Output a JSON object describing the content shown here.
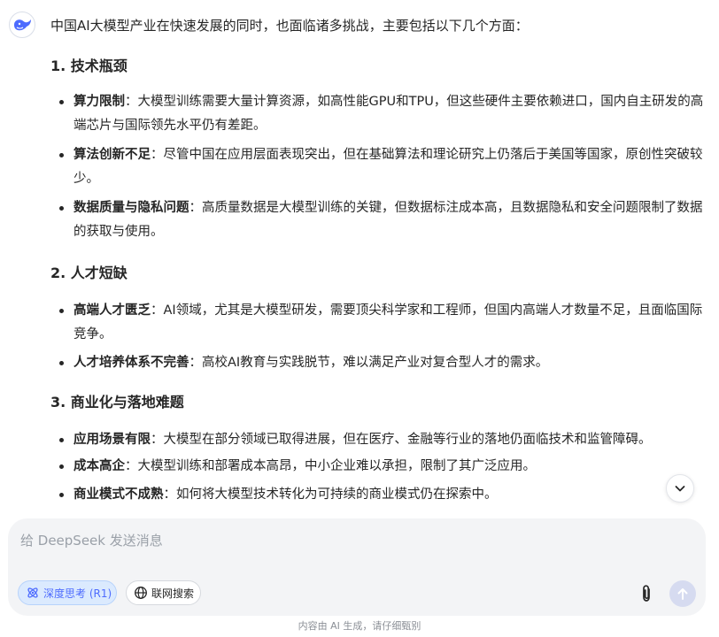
{
  "message": {
    "intro": "中国AI大模型产业在快速发展的同时，也面临诸多挑战，主要包括以下几个方面：",
    "sections": [
      {
        "title": "1. 技术瓶颈",
        "items": [
          {
            "term": "算力限制",
            "text": "：大模型训练需要大量计算资源，如高性能GPU和TPU，但这些硬件主要依赖进口，国内自主研发的高端芯片与国际领先水平仍有差距。"
          },
          {
            "term": "算法创新不足",
            "text": "：尽管中国在应用层面表现突出，但在基础算法和理论研究上仍落后于美国等国家，原创性突破较少。"
          },
          {
            "term": "数据质量与隐私问题",
            "text": "：高质量数据是大模型训练的关键，但数据标注成本高，且数据隐私和安全问题限制了数据的获取与使用。"
          }
        ]
      },
      {
        "title": "2. 人才短缺",
        "items": [
          {
            "term": "高端人才匮乏",
            "text": "：AI领域，尤其是大模型研发，需要顶尖科学家和工程师，但国内高端人才数量不足，且面临国际竞争。"
          },
          {
            "term": "人才培养体系不完善",
            "text": "：高校AI教育与实践脱节，难以满足产业对复合型人才的需求。"
          }
        ]
      },
      {
        "title": "3. 商业化与落地难题",
        "items": [
          {
            "term": "应用场景有限",
            "text": "：大模型在部分领域已取得进展，但在医疗、金融等行业的落地仍面临技术和监管障碍。"
          },
          {
            "term": "成本高企",
            "text": "：大模型训练和部署成本高昂，中小企业难以承担，限制了其广泛应用。"
          },
          {
            "term": "商业模式不成熟",
            "text": "：如何将大模型技术转化为可持续的商业模式仍在探索中。"
          }
        ]
      }
    ]
  },
  "composer": {
    "placeholder": "给 DeepSeek 发送消息",
    "value": "",
    "deep_think_label": "深度思考 (R1)",
    "web_search_label": "联网搜索"
  },
  "footer": {
    "notice": "内容由 AI 生成，请仔细甄别"
  },
  "icons": {
    "avatar": "deepseek-whale-icon",
    "scroll": "chevron-down-icon",
    "deep_think": "atom-icon",
    "web_search": "globe-icon",
    "attach": "paperclip-icon",
    "send": "arrow-up-icon"
  },
  "colors": {
    "accent": "#4d6bfe",
    "composer_bg": "#f3f4f6",
    "send_disabled": "#d6dbf0"
  }
}
